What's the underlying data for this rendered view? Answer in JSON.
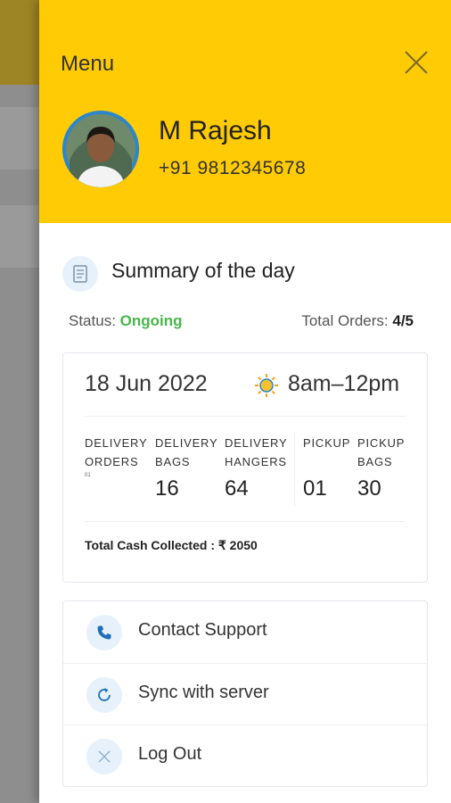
{
  "drawer": {
    "title": "Menu",
    "close_icon": "close-icon",
    "colors": {
      "header": "#ffcb05",
      "status_ongoing": "#49b54a",
      "accent_blue": "#1e6fb8"
    }
  },
  "user": {
    "name": "M Rajesh",
    "phone": "+91 9812345678"
  },
  "summary": {
    "title": "Summary of the day",
    "icon": "document-icon",
    "status_label": "Status:",
    "status_value": "Ongoing",
    "orders_label": "Total Orders:",
    "orders_value": "4/5",
    "date": "18 Jun 2022",
    "time_icon": "sun-icon",
    "time_slot": "8am–12pm",
    "stats": [
      {
        "label": "DELIVERY\nORDERS",
        "value": "",
        "sub": "01"
      },
      {
        "label": "DELIVERY\nBAGS",
        "value": "16"
      },
      {
        "label": "DELIVERY\nHANGERS",
        "value": "64"
      },
      {
        "label": "PICKUP",
        "value": "01"
      },
      {
        "label": "PICKUP\nBAGS",
        "value": "30"
      }
    ],
    "cash": "Total Cash Collected : ₹ 2050"
  },
  "actions": [
    {
      "label": "Contact Support",
      "icon": "phone-icon"
    },
    {
      "label": "Sync with server",
      "icon": "sync-icon"
    },
    {
      "label": "Log Out",
      "icon": "close-icon"
    }
  ]
}
